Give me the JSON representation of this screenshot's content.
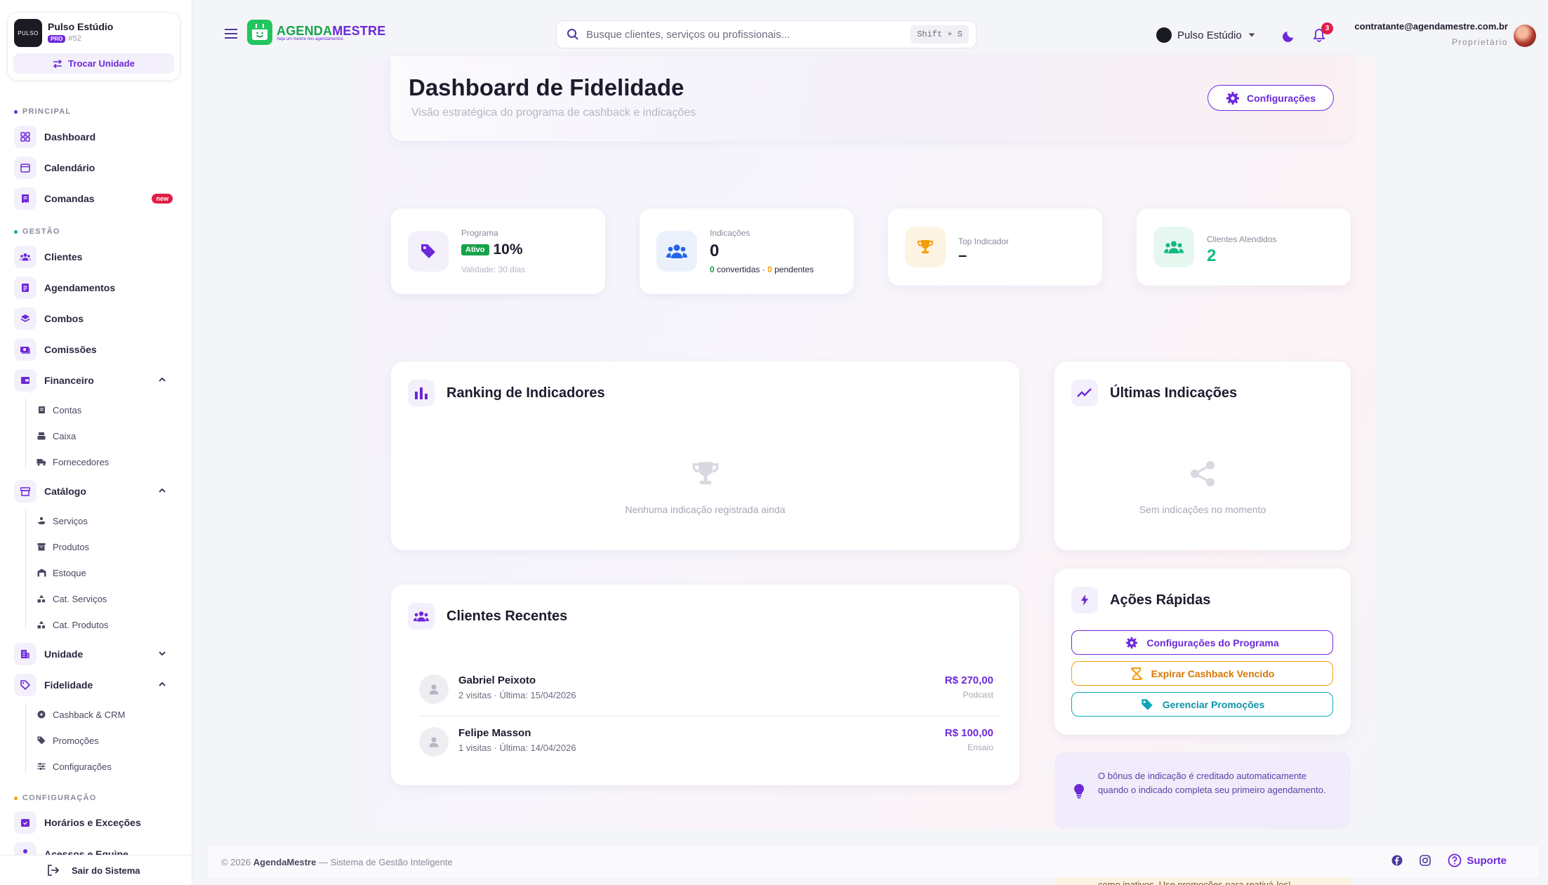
{
  "sidebar": {
    "unit": {
      "name": "Pulso Estúdio",
      "plan": "PRO",
      "id": "#52",
      "logo_text": "PULSO",
      "switch_label": "Trocar Unidade"
    },
    "sections": {
      "principal": "PRINCIPAL",
      "gestao": "GESTÃO",
      "configuracao": "CONFIGURAÇÃO"
    },
    "items": {
      "dashboard": "Dashboard",
      "calendario": "Calendário",
      "comandas": "Comandas",
      "comandas_badge": "new",
      "clientes": "Clientes",
      "agendamentos": "Agendamentos",
      "combos": "Combos",
      "comissoes": "Comissões",
      "financeiro": "Financeiro",
      "contas": "Contas",
      "caixa": "Caixa",
      "fornecedores": "Fornecedores",
      "catalogo": "Catálogo",
      "servicos": "Serviços",
      "produtos": "Produtos",
      "estoque": "Estoque",
      "cat_servicos": "Cat. Serviços",
      "cat_produtos": "Cat. Produtos",
      "unidade": "Unidade",
      "fidelidade": "Fidelidade",
      "cashback": "Cashback & CRM",
      "promocoes": "Promoções",
      "configuracoes": "Configurações",
      "horarios": "Horários e Exceções",
      "acessos": "Acessos e Equipe"
    },
    "logout": "Sair do Sistema"
  },
  "header": {
    "brand_a": "AGENDA",
    "brand_b": "MESTRE",
    "brand_tag": "Seja um mestre nos agendamentos",
    "search_placeholder": "Busque clientes, serviços ou profissionais...",
    "search_shortcut": "Shift + S",
    "unit_selector": "Pulso Estúdio",
    "notifications": "3",
    "user_email": "contratante@agendamestre.com.br",
    "user_role": "Proprietário"
  },
  "page": {
    "title": "Dashboard de Fidelidade",
    "subtitle": "Visão estratégica do programa de cashback e indicações",
    "config_button": "Configurações"
  },
  "stats": {
    "programa": {
      "label": "Programa",
      "status": "Ativo",
      "value": "10%",
      "sub": "Validade: 30 dias"
    },
    "indicacoes": {
      "label": "Indicações",
      "value": "0",
      "converted_count": "0",
      "converted_label": "convertidas",
      "sep": "·",
      "pending_count": "0",
      "pending_label": "pendentes"
    },
    "top": {
      "label": "Top Indicador",
      "value": "–"
    },
    "atendidos": {
      "label": "Clientes Atendidos",
      "value": "2"
    }
  },
  "ranking": {
    "title": "Ranking de Indicadores",
    "empty": "Nenhuma indicação registrada ainda"
  },
  "ultimas": {
    "title": "Últimas Indicações",
    "empty": "Sem indicações no momento"
  },
  "recentes": {
    "title": "Clientes Recentes",
    "rows": [
      {
        "name": "Gabriel Peixoto",
        "meta": "2 visitas · Última: 15/04/2026",
        "amount": "R$ 270,00",
        "tag": "Podcast"
      },
      {
        "name": "Felipe Masson",
        "meta": "1 visitas · Última: 14/04/2026",
        "amount": "R$ 100,00",
        "tag": "Ensaio"
      }
    ]
  },
  "acoes": {
    "title": "Ações Rápidas",
    "btn_config": "Configurações do Programa",
    "btn_expirar": "Expirar Cashback Vencido",
    "btn_promocoes": "Gerenciar Promoções"
  },
  "info": {
    "text": "O bônus de indicação é creditado automaticamente quando o indicado completa seu primeiro agendamento.",
    "peek_text": "como inativos. Use promoções para reativá-los!"
  },
  "footer": {
    "year": "© 2026",
    "brand": "AgendaMestre",
    "rest": "— Sistema de Gestão Inteligente",
    "support": "Suporte"
  },
  "colors": {
    "primary": "#6d28d9",
    "green": "#16a34a",
    "orange": "#f59e0b",
    "teal": "#0ea5b7",
    "danger": "#e11d48"
  }
}
